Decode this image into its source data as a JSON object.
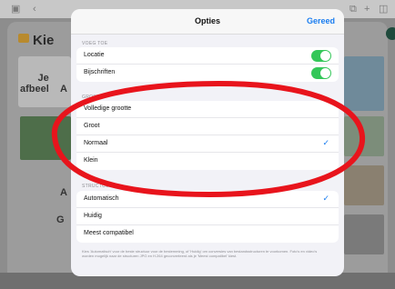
{
  "background": {
    "app_heading": "Kie",
    "card_text_line1": "Je",
    "card_text_line2": "afbeel",
    "left_letter_a1": "A",
    "left_letter_a2": "A",
    "left_letter_g": "G"
  },
  "modal": {
    "title": "Opties",
    "done_label": "Gereed",
    "include_section": {
      "label": "VOEG TOE",
      "items": [
        {
          "label": "Locatie",
          "enabled": true
        },
        {
          "label": "Bijschriften",
          "enabled": true
        }
      ]
    },
    "size_section": {
      "label": "GROOTTE",
      "items": [
        {
          "label": "Volledige grootte",
          "selected": false
        },
        {
          "label": "Groot",
          "selected": false
        },
        {
          "label": "Normaal",
          "selected": true
        },
        {
          "label": "Klein",
          "selected": false
        }
      ]
    },
    "format_section": {
      "label": "STRUCTUUR",
      "items": [
        {
          "label": "Automatisch",
          "selected": true
        },
        {
          "label": "Huidig",
          "selected": false
        },
        {
          "label": "Meest compatibel",
          "selected": false
        }
      ]
    },
    "footnote": "Kies 'Automatisch' voor de beste structuur voor de bestemming, of 'Huidig' om conversies van bestandsstructuren te voorkomen. Foto's en video's worden mogelijk naar de structuren JPG en H.264 geconverteerd als je 'Meest compatibel' kiest."
  },
  "colors": {
    "accent": "#1a7df0",
    "toggle_on": "#34c759",
    "annotation": "#e8141c"
  }
}
